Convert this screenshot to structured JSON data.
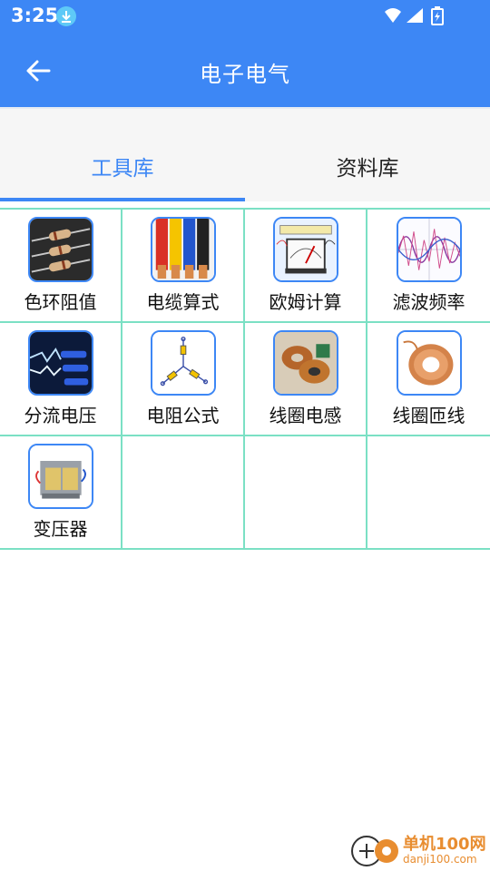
{
  "status": {
    "time": "3:25"
  },
  "appbar": {
    "title": "电子电气",
    "back_icon": "arrow-left-icon"
  },
  "tabs": [
    {
      "label": "工具库",
      "active": true
    },
    {
      "label": "资料库",
      "active": false
    }
  ],
  "tools": [
    {
      "label": "色环阻值",
      "icon": "resistor-color-icon"
    },
    {
      "label": "电缆算式",
      "icon": "cable-icon"
    },
    {
      "label": "欧姆计算",
      "icon": "multimeter-icon"
    },
    {
      "label": "滤波频率",
      "icon": "waveform-icon"
    },
    {
      "label": "分流电压",
      "icon": "electric-arc-icon"
    },
    {
      "label": "电阻公式",
      "icon": "resistor-network-icon"
    },
    {
      "label": "线圈电感",
      "icon": "inductor-coil-icon"
    },
    {
      "label": "线圈匝线",
      "icon": "copper-coil-icon"
    },
    {
      "label": "变压器",
      "icon": "transformer-icon"
    }
  ],
  "watermark": {
    "name": "单机100网",
    "url": "danji100.com"
  },
  "colors": {
    "primary": "#3d87f5",
    "grid_line": "#7be0c4",
    "watermark": "#e88d30"
  }
}
